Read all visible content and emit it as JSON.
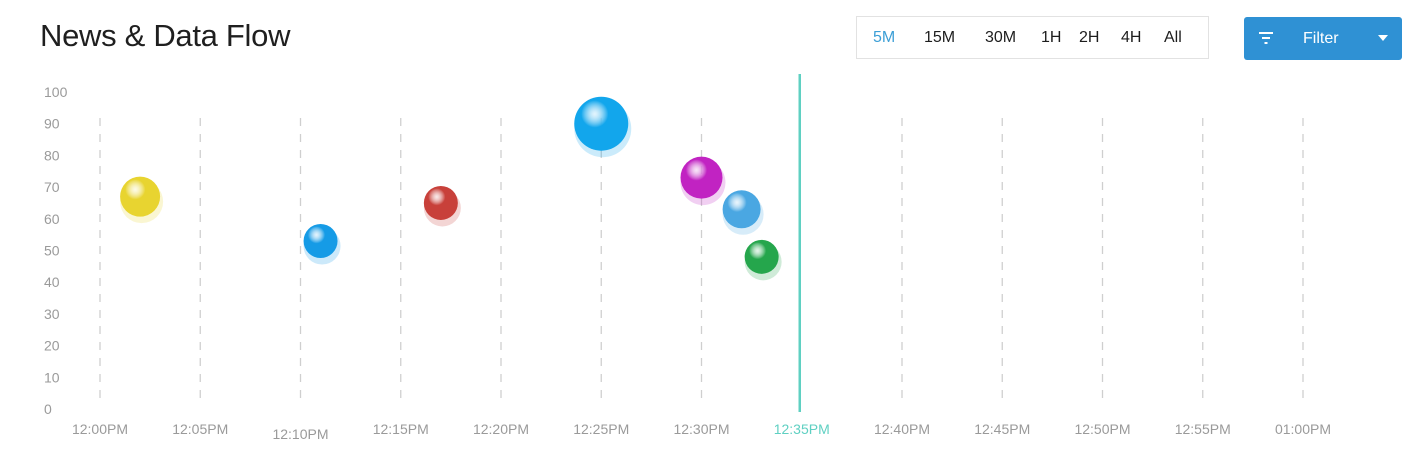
{
  "title": "News & Data Flow",
  "time_ranges": [
    {
      "label": "5M",
      "active": true
    },
    {
      "label": "15M",
      "active": false
    },
    {
      "label": "30M",
      "active": false
    },
    {
      "label": "1H",
      "active": false
    },
    {
      "label": "2H",
      "active": false
    },
    {
      "label": "4H",
      "active": false
    },
    {
      "label": "All",
      "active": false
    }
  ],
  "filter": {
    "label": "Filter",
    "icon": "filter-icon",
    "caret": "chevron-down-icon",
    "color": "#2f91d4"
  },
  "chart_data": {
    "type": "scatter",
    "title": "",
    "xlabel": "",
    "ylabel": "",
    "ylim": [
      0,
      100
    ],
    "y_ticks": [
      0,
      10,
      20,
      30,
      40,
      50,
      60,
      70,
      80,
      90,
      100
    ],
    "x_ticks": [
      "12:00PM",
      "12:05PM",
      "12:10PM",
      "12:15PM",
      "12:20PM",
      "12:25PM",
      "12:30PM",
      "12:35PM",
      "12:40PM",
      "12:45PM",
      "12:50PM",
      "12:55PM",
      "01:00PM"
    ],
    "current_time": "12:35PM",
    "current_color": "#5fd0c2",
    "grid": "vertical dashed",
    "points": [
      {
        "x": "12:02PM",
        "y": 67,
        "size": 20,
        "color": "#e8d430"
      },
      {
        "x": "12:11PM",
        "y": 53,
        "size": 17,
        "color": "#159be6"
      },
      {
        "x": "12:17PM",
        "y": 65,
        "size": 17,
        "color": "#c8403a"
      },
      {
        "x": "12:25PM",
        "y": 90,
        "size": 27,
        "color": "#12a6ec"
      },
      {
        "x": "12:30PM",
        "y": 73,
        "size": 21,
        "color": "#c123c2"
      },
      {
        "x": "12:32PM",
        "y": 63,
        "size": 19,
        "color": "#4aa7e2"
      },
      {
        "x": "12:33PM",
        "y": 48,
        "size": 17,
        "color": "#25a64c"
      }
    ]
  }
}
